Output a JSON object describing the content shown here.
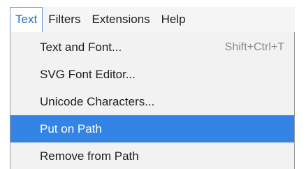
{
  "menubar": {
    "items": [
      {
        "label": "Text",
        "active": true
      },
      {
        "label": "Filters",
        "active": false
      },
      {
        "label": "Extensions",
        "active": false
      },
      {
        "label": "Help",
        "active": false
      }
    ]
  },
  "menu": {
    "items": [
      {
        "label": "Text and Font...",
        "shortcut": "Shift+Ctrl+T",
        "highlighted": false
      },
      {
        "label": "SVG Font Editor...",
        "shortcut": "",
        "highlighted": false
      },
      {
        "label": "Unicode Characters...",
        "shortcut": "",
        "highlighted": false
      },
      {
        "label": "Put on Path",
        "shortcut": "",
        "highlighted": true
      },
      {
        "label": "Remove from Path",
        "shortcut": "",
        "highlighted": false
      }
    ]
  },
  "colors": {
    "highlight": "#3384e4",
    "active_menu_text": "#2a6fcf",
    "menu_background": "#f2f2f2"
  }
}
